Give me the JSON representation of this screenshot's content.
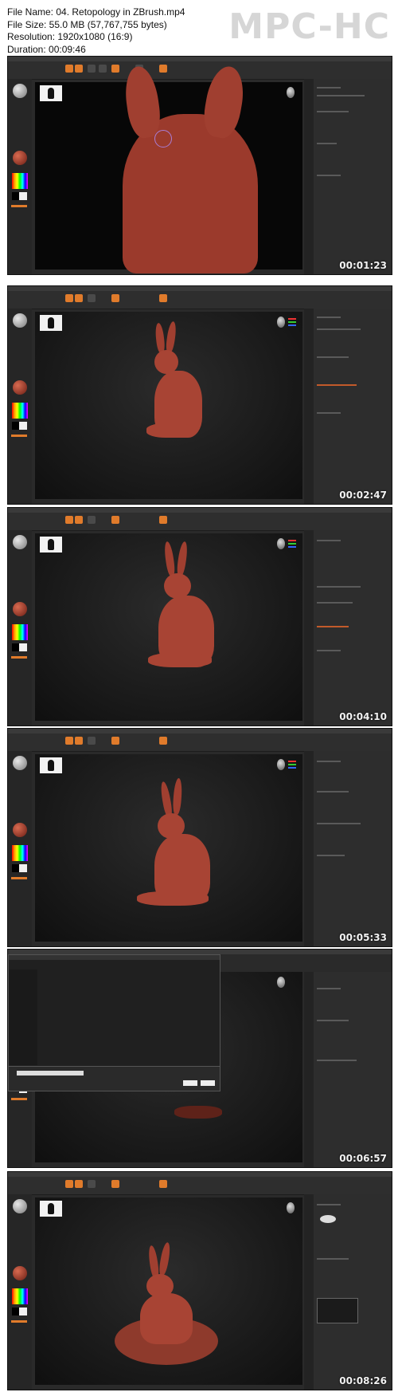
{
  "info": {
    "file_name": "File Name: 04. Retopology in ZBrush.mp4",
    "file_size": "File Size: 55.0 MB (57,767,755 bytes)",
    "resolution": "Resolution: 1920x1080 (16:9)",
    "duration": "Duration: 00:09:46"
  },
  "logo": "MPC-HC",
  "frames": [
    {
      "timestamp": "00:01:23",
      "scene": "closeup"
    },
    {
      "timestamp": "00:02:47",
      "scene": "bunny"
    },
    {
      "timestamp": "00:04:10",
      "scene": "bunny"
    },
    {
      "timestamp": "00:05:33",
      "scene": "bunny-side"
    },
    {
      "timestamp": "00:06:57",
      "scene": "file-dialog"
    },
    {
      "timestamp": "00:08:26",
      "scene": "bunny-base"
    }
  ],
  "colors": {
    "accent": "#e07b2b",
    "clay": "#a84434",
    "ui_bg": "#2a2a2a"
  }
}
